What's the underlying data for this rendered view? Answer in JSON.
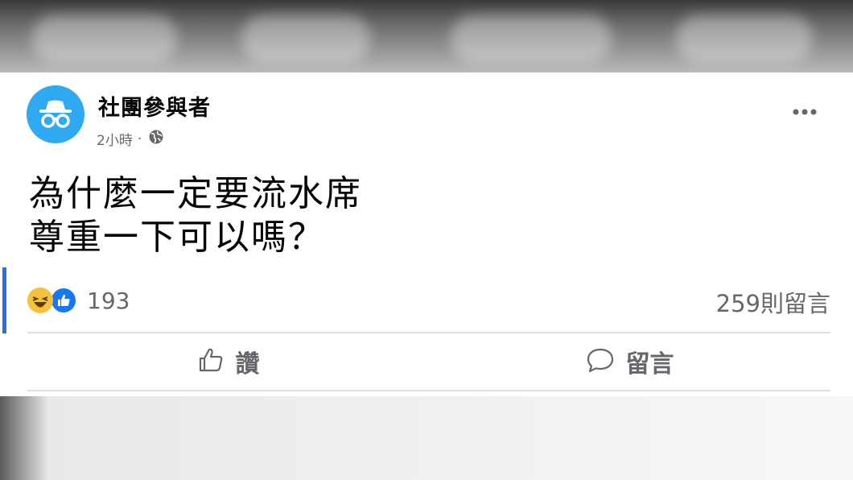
{
  "post": {
    "author": "社團參與者",
    "time": "2小時",
    "separator": "·",
    "lines": [
      "為什麼一定要流水席",
      "尊重一下可以嗎？"
    ],
    "reaction_count": "193",
    "comment_count": "259則留言"
  },
  "actions": {
    "like_label": "讚",
    "comment_label": "留言"
  },
  "icons": {
    "avatar": "anonymous-icon",
    "privacy": "globe-icon",
    "more": "more-horizontal-icon",
    "reaction_1": "haha-reaction-icon",
    "reaction_2": "like-reaction-icon",
    "like_action": "thumbs-up-icon",
    "comment_action": "comment-bubble-icon"
  },
  "colors": {
    "avatar_bg": "#2fa9f2",
    "like_blue": "#1877f2",
    "muted_text": "#65676b",
    "accent_bar": "#2d6fe0"
  }
}
